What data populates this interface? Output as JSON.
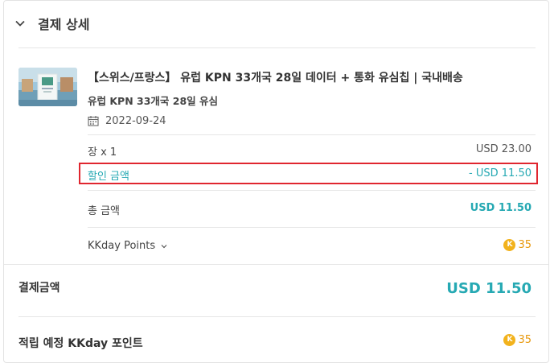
{
  "header": {
    "title": "결제 상세",
    "toggle_icon": "chevron-down-icon"
  },
  "product": {
    "title": "【스위스/프랑스】 유럽 KPN 33개국 28일 데이터 + 통화 유심칩 | 국내배송",
    "subtitle": "유럽 KPN 33개국 28일 유심",
    "date": "2022-09-24",
    "date_icon": "calendar-icon"
  },
  "breakdown": {
    "quantity_label": "장 x 1",
    "quantity_value": "USD 23.00",
    "discount_label": "할인 금액",
    "discount_value": "- USD 11.50",
    "total_label": "총 금액",
    "total_value": "USD 11.50",
    "points_label": "KKday Points",
    "points_value": "35",
    "points_coin": "K"
  },
  "payment": {
    "label": "결제금액",
    "value": "USD 11.50"
  },
  "reward": {
    "label": "적립 예정 KKday 포인트",
    "value": "35",
    "coin": "K"
  },
  "colors": {
    "accent": "#26a9b3",
    "highlight_border": "#e0262f",
    "coin": "#f2b21c",
    "points_text": "#e89a10"
  }
}
